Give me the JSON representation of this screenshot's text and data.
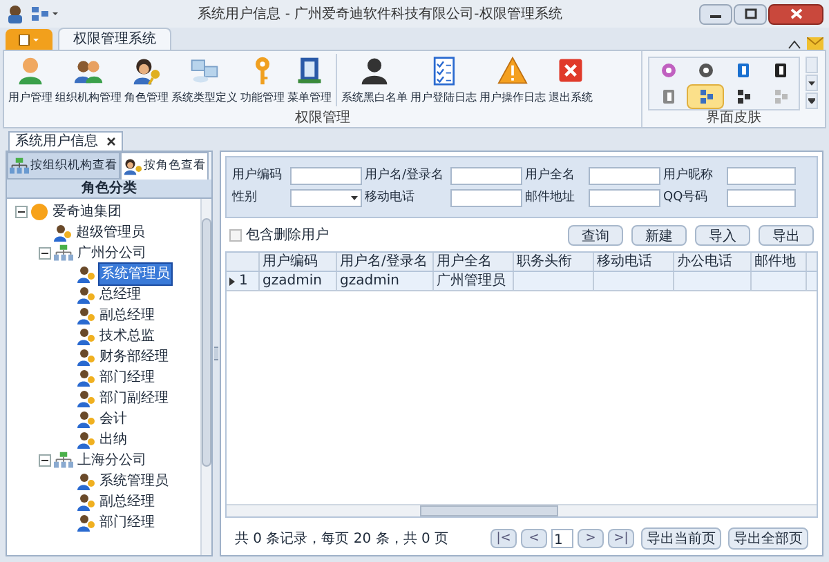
{
  "window": {
    "title": "系统用户信息 - 广州爱奇迪软件科技有限公司-权限管理系统"
  },
  "ribbon": {
    "tabs": [
      {
        "label": "权限管理系统",
        "selected": true
      }
    ],
    "groups": [
      {
        "label": "权限管理",
        "items": [
          {
            "label": "用户管理"
          },
          {
            "label": "组织机构管理"
          },
          {
            "label": "角色管理"
          },
          {
            "label": "系统类型定义"
          },
          {
            "label": "功能管理"
          },
          {
            "label": "菜单管理"
          },
          {
            "label": "系统黑白名单"
          },
          {
            "label": "用户登陆日志"
          },
          {
            "label": "用户操作日志"
          },
          {
            "label": "退出系统"
          }
        ]
      },
      {
        "label": "界面皮肤",
        "skins": [
          {
            "selected": false
          },
          {
            "selected": false
          },
          {
            "selected": false
          },
          {
            "selected": false
          },
          {
            "selected": false
          },
          {
            "selected": true
          },
          {
            "selected": false
          },
          {
            "selected": false
          }
        ]
      }
    ]
  },
  "document_tabs": [
    {
      "label": "系统用户信息",
      "selected": true
    }
  ],
  "left_panel": {
    "view_tabs": [
      {
        "label": "按组织机构查看",
        "selected": false
      },
      {
        "label": "按角色查看",
        "selected": true
      }
    ],
    "header": "角色分类",
    "tree": [
      {
        "label": "爱奇迪集团",
        "kind": "company",
        "expanded": true,
        "selected": false,
        "children": [
          {
            "label": "超级管理员",
            "kind": "role",
            "selected": false
          },
          {
            "label": "广州分公司",
            "kind": "branch",
            "expanded": true,
            "selected": false,
            "children": [
              {
                "label": "系统管理员",
                "kind": "role",
                "selected": true
              },
              {
                "label": "总经理",
                "kind": "role",
                "selected": false
              },
              {
                "label": "副总经理",
                "kind": "role",
                "selected": false
              },
              {
                "label": "技术总监",
                "kind": "role",
                "selected": false
              },
              {
                "label": "财务部经理",
                "kind": "role",
                "selected": false
              },
              {
                "label": "部门经理",
                "kind": "role",
                "selected": false
              },
              {
                "label": "部门副经理",
                "kind": "role",
                "selected": false
              },
              {
                "label": "会计",
                "kind": "role",
                "selected": false
              },
              {
                "label": "出纳",
                "kind": "role",
                "selected": false
              }
            ]
          },
          {
            "label": "上海分公司",
            "kind": "branch",
            "expanded": true,
            "selected": false,
            "children": [
              {
                "label": "系统管理员",
                "kind": "role",
                "selected": false
              },
              {
                "label": "副总经理",
                "kind": "role",
                "selected": false
              },
              {
                "label": "部门经理",
                "kind": "role",
                "selected": false
              }
            ]
          }
        ]
      }
    ]
  },
  "filters": [
    {
      "label": "用户编码",
      "kind": "text"
    },
    {
      "label": "用户名/登录名",
      "kind": "text"
    },
    {
      "label": "用户全名",
      "kind": "text"
    },
    {
      "label": "用户昵称",
      "kind": "text"
    },
    {
      "label": "性别",
      "kind": "dropdown"
    },
    {
      "label": "移动电话",
      "kind": "text"
    },
    {
      "label": "邮件地址",
      "kind": "text"
    },
    {
      "label": "QQ号码",
      "kind": "text"
    }
  ],
  "include_deleted": {
    "label": "包含删除用户",
    "checked": false
  },
  "actions": [
    "查询",
    "新建",
    "导入",
    "导出"
  ],
  "table": {
    "columns": [
      "用户编码",
      "用户名/登录名",
      "用户全名",
      "职务头衔",
      "移动电话",
      "办公电话",
      "邮件地"
    ],
    "rows": [
      {
        "number": "1",
        "current": true,
        "cells": [
          "gzadmin",
          "gzadmin",
          "广州管理员",
          "",
          "",
          "",
          ""
        ]
      }
    ]
  },
  "pager": {
    "summary": "共 0 条记录，每页 20 条，共 0 页",
    "buttons": [
      "|<",
      "<",
      ">",
      ">|"
    ],
    "page": "1",
    "exports": [
      "导出当前页",
      "导出全部页"
    ]
  }
}
